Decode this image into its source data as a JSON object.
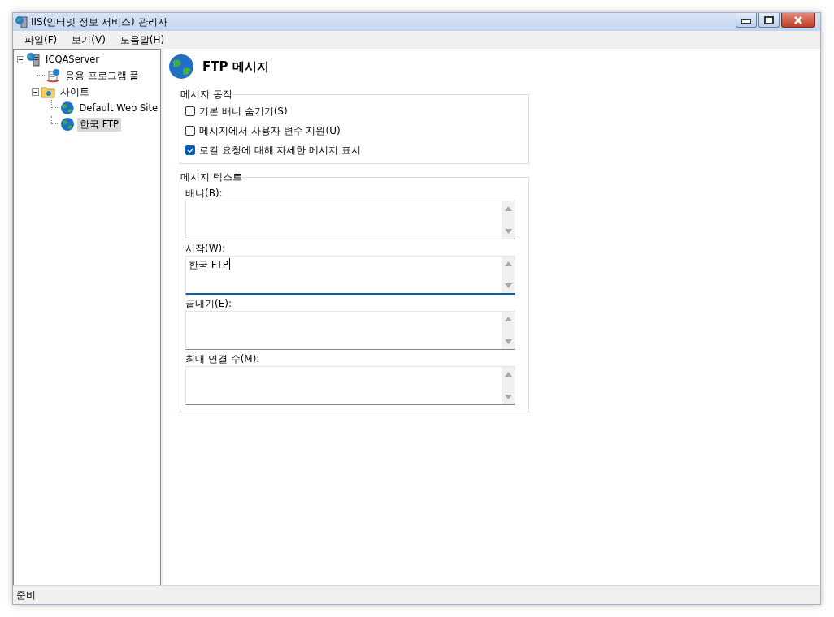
{
  "window": {
    "title": "IIS(인터넷 정보 서비스) 관리자"
  },
  "menu": [
    {
      "label": "파일(F)"
    },
    {
      "label": "보기(V)"
    },
    {
      "label": "도움말(H)"
    }
  ],
  "tree": [
    {
      "label": "ICQAServer",
      "kind": "server",
      "expanded": true,
      "selected": false,
      "children": [
        {
          "label": "응용 프로그램 풀",
          "kind": "pool",
          "selected": false
        },
        {
          "label": "사이트",
          "kind": "folder",
          "expanded": true,
          "selected": false,
          "children": [
            {
              "label": "Default Web Site",
              "kind": "globe",
              "selected": false
            },
            {
              "label": "한국 FTP",
              "kind": "globe",
              "selected": true
            }
          ]
        }
      ]
    }
  ],
  "page": {
    "title": "FTP 메시지",
    "behavior": {
      "legend": "메시지 동작",
      "options": [
        {
          "label": "기본 배너 숨기기(S)",
          "checked": false
        },
        {
          "label": "메시지에서 사용자 변수 지원(U)",
          "checked": false
        },
        {
          "label": "로컬 요청에 대해 자세한 메시지 표시",
          "checked": true
        }
      ]
    },
    "texts": {
      "legend": "메시지 텍스트",
      "fields": [
        {
          "label": "배너(B):",
          "focused": false
        },
        {
          "label": "시작(W):",
          "value": "한국 FTP",
          "focused": true
        },
        {
          "label": "끝내기(E):",
          "focused": false
        },
        {
          "label": "최대 연결 수(M):",
          "focused": false
        }
      ]
    }
  },
  "status_bar": {
    "text": "준비"
  }
}
